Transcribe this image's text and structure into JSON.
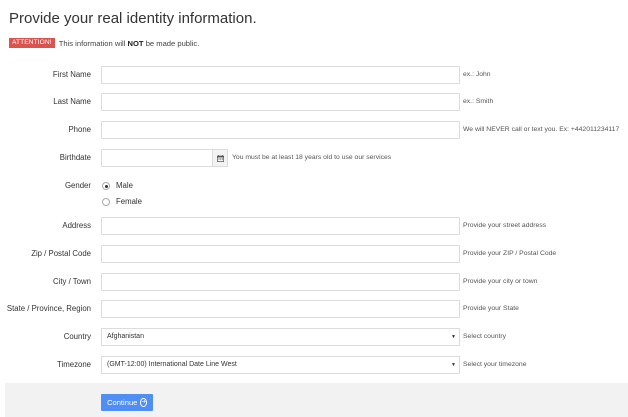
{
  "page": {
    "title": "Provide your real identity information.",
    "notice_badge": "ATTENTION!",
    "notice_before": "This information will",
    "notice_bold": "NOT",
    "notice_after": "be made public."
  },
  "fields": {
    "first_name": {
      "label": "First Name",
      "help": "ex.: John"
    },
    "last_name": {
      "label": "Last Name",
      "help": "ex.: Smith"
    },
    "phone": {
      "label": "Phone",
      "help": "We will NEVER call or text you. Ex: +442011234117"
    },
    "birthdate": {
      "label": "Birthdate",
      "help": "You must be at least 18 years old to use our services",
      "calendar_icon": "calendar-icon"
    },
    "gender": {
      "label": "Gender",
      "options": [
        "Male",
        "Female"
      ],
      "selected": "Male"
    },
    "address": {
      "label": "Address",
      "help": "Provide your street address"
    },
    "zip": {
      "label": "Zip / Postal Code",
      "help": "Provide your ZIP / Postal Code"
    },
    "city": {
      "label": "City / Town",
      "help": "Provide your city or town"
    },
    "state": {
      "label": "State / Province, Region",
      "help": "Provide your State"
    },
    "country": {
      "label": "Country",
      "value": "Afghanistan",
      "help": "Select country"
    },
    "timezone": {
      "label": "Timezone",
      "value": "(GMT-12:00) International Date Line West",
      "help": "Select your timezone"
    }
  },
  "footer": {
    "continue_label": "Continue",
    "continue_icon": "arrow-right-circle-icon",
    "accent": "#4f8ef5"
  }
}
